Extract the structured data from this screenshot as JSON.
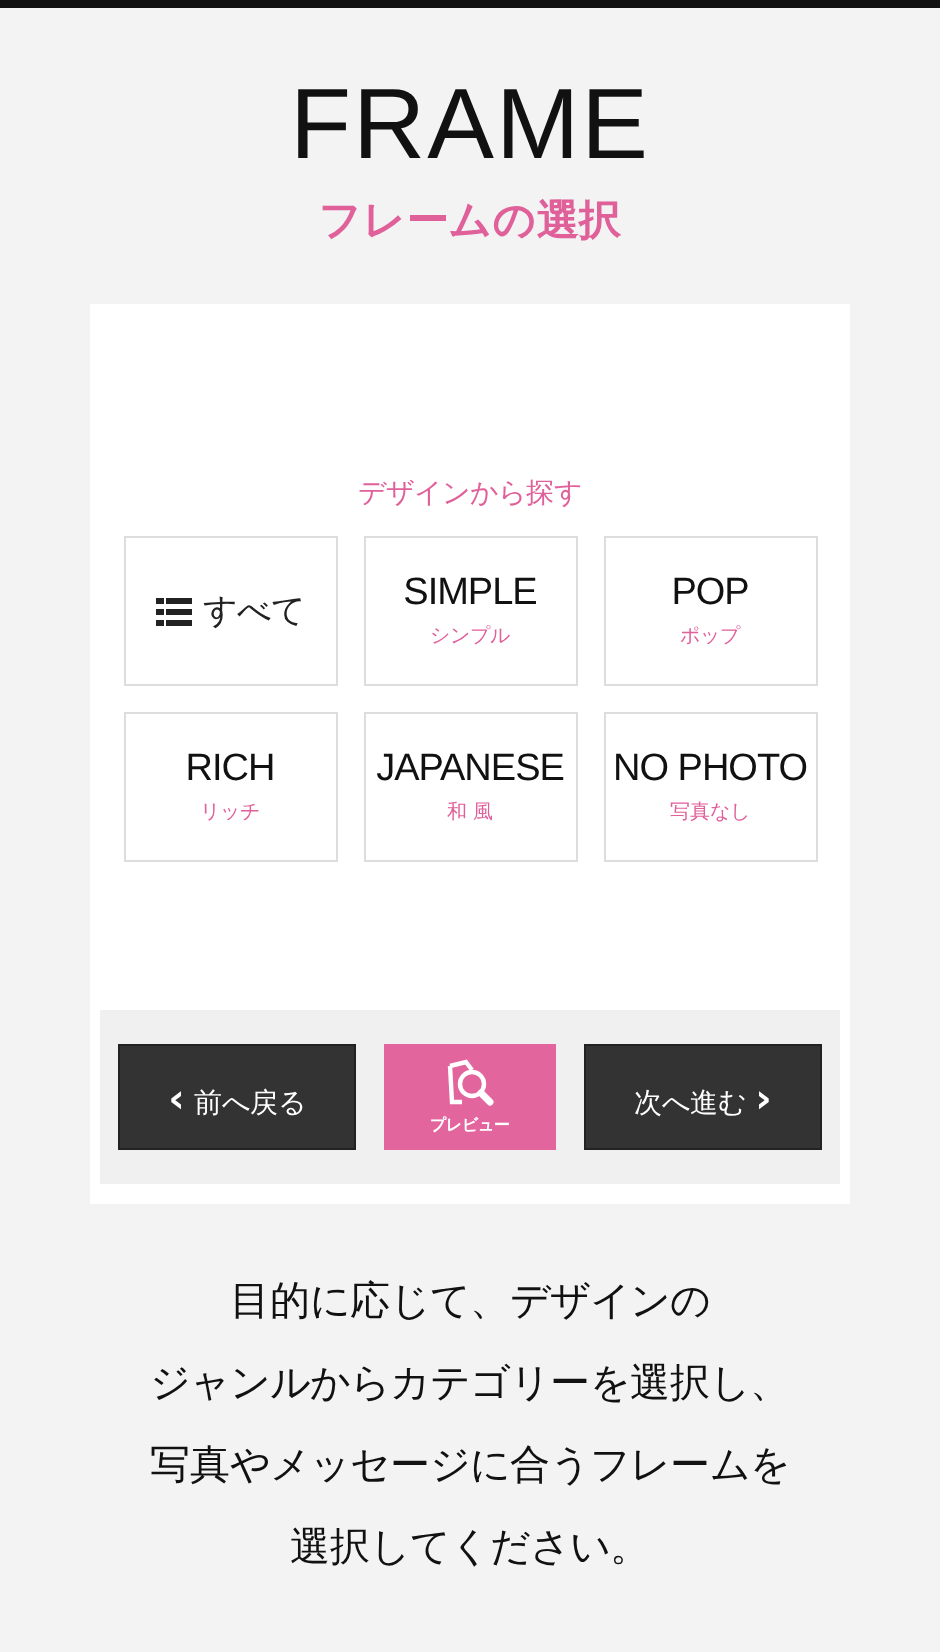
{
  "header": {
    "title": "FRAME",
    "subtitle": "フレームの選択"
  },
  "category": {
    "heading": "デザインから探す",
    "tiles": [
      {
        "kind": "all",
        "label": "すべて"
      },
      {
        "kind": "style",
        "label": "SIMPLE",
        "sub": "シンプル"
      },
      {
        "kind": "style",
        "label": "POP",
        "sub": "ポップ"
      },
      {
        "kind": "style",
        "label": "RICH",
        "sub": "リッチ"
      },
      {
        "kind": "style",
        "label": "JAPANESE",
        "sub": "和 風"
      },
      {
        "kind": "style",
        "label": "NO PHOTO",
        "sub": "写真なし"
      }
    ]
  },
  "nav": {
    "back": {
      "arrow": "‹",
      "label": "前へ戻る"
    },
    "preview": {
      "label": "プレビュー"
    },
    "next": {
      "arrow": "›",
      "label": "次へ進む"
    }
  },
  "description": [
    "目的に応じて、デザインの",
    "ジャンルからカテゴリーを選択し、",
    "写真やメッセージに合うフレームを",
    "選択してください。"
  ]
}
